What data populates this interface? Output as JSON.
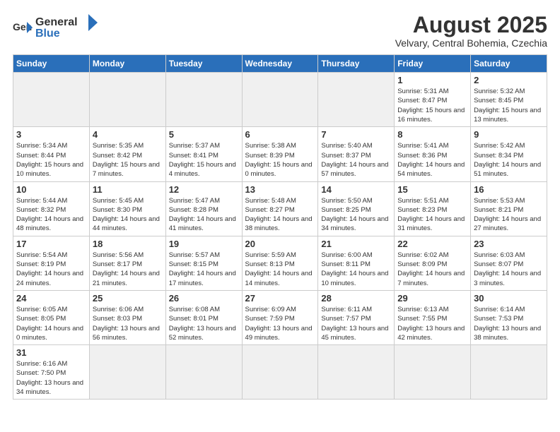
{
  "header": {
    "logo_general": "General",
    "logo_blue": "Blue",
    "month_title": "August 2025",
    "subtitle": "Velvary, Central Bohemia, Czechia"
  },
  "weekdays": [
    "Sunday",
    "Monday",
    "Tuesday",
    "Wednesday",
    "Thursday",
    "Friday",
    "Saturday"
  ],
  "weeks": [
    [
      {
        "day": "",
        "info": ""
      },
      {
        "day": "",
        "info": ""
      },
      {
        "day": "",
        "info": ""
      },
      {
        "day": "",
        "info": ""
      },
      {
        "day": "",
        "info": ""
      },
      {
        "day": "1",
        "info": "Sunrise: 5:31 AM\nSunset: 8:47 PM\nDaylight: 15 hours and 16 minutes."
      },
      {
        "day": "2",
        "info": "Sunrise: 5:32 AM\nSunset: 8:45 PM\nDaylight: 15 hours and 13 minutes."
      }
    ],
    [
      {
        "day": "3",
        "info": "Sunrise: 5:34 AM\nSunset: 8:44 PM\nDaylight: 15 hours and 10 minutes."
      },
      {
        "day": "4",
        "info": "Sunrise: 5:35 AM\nSunset: 8:42 PM\nDaylight: 15 hours and 7 minutes."
      },
      {
        "day": "5",
        "info": "Sunrise: 5:37 AM\nSunset: 8:41 PM\nDaylight: 15 hours and 4 minutes."
      },
      {
        "day": "6",
        "info": "Sunrise: 5:38 AM\nSunset: 8:39 PM\nDaylight: 15 hours and 0 minutes."
      },
      {
        "day": "7",
        "info": "Sunrise: 5:40 AM\nSunset: 8:37 PM\nDaylight: 14 hours and 57 minutes."
      },
      {
        "day": "8",
        "info": "Sunrise: 5:41 AM\nSunset: 8:36 PM\nDaylight: 14 hours and 54 minutes."
      },
      {
        "day": "9",
        "info": "Sunrise: 5:42 AM\nSunset: 8:34 PM\nDaylight: 14 hours and 51 minutes."
      }
    ],
    [
      {
        "day": "10",
        "info": "Sunrise: 5:44 AM\nSunset: 8:32 PM\nDaylight: 14 hours and 48 minutes."
      },
      {
        "day": "11",
        "info": "Sunrise: 5:45 AM\nSunset: 8:30 PM\nDaylight: 14 hours and 44 minutes."
      },
      {
        "day": "12",
        "info": "Sunrise: 5:47 AM\nSunset: 8:28 PM\nDaylight: 14 hours and 41 minutes."
      },
      {
        "day": "13",
        "info": "Sunrise: 5:48 AM\nSunset: 8:27 PM\nDaylight: 14 hours and 38 minutes."
      },
      {
        "day": "14",
        "info": "Sunrise: 5:50 AM\nSunset: 8:25 PM\nDaylight: 14 hours and 34 minutes."
      },
      {
        "day": "15",
        "info": "Sunrise: 5:51 AM\nSunset: 8:23 PM\nDaylight: 14 hours and 31 minutes."
      },
      {
        "day": "16",
        "info": "Sunrise: 5:53 AM\nSunset: 8:21 PM\nDaylight: 14 hours and 27 minutes."
      }
    ],
    [
      {
        "day": "17",
        "info": "Sunrise: 5:54 AM\nSunset: 8:19 PM\nDaylight: 14 hours and 24 minutes."
      },
      {
        "day": "18",
        "info": "Sunrise: 5:56 AM\nSunset: 8:17 PM\nDaylight: 14 hours and 21 minutes."
      },
      {
        "day": "19",
        "info": "Sunrise: 5:57 AM\nSunset: 8:15 PM\nDaylight: 14 hours and 17 minutes."
      },
      {
        "day": "20",
        "info": "Sunrise: 5:59 AM\nSunset: 8:13 PM\nDaylight: 14 hours and 14 minutes."
      },
      {
        "day": "21",
        "info": "Sunrise: 6:00 AM\nSunset: 8:11 PM\nDaylight: 14 hours and 10 minutes."
      },
      {
        "day": "22",
        "info": "Sunrise: 6:02 AM\nSunset: 8:09 PM\nDaylight: 14 hours and 7 minutes."
      },
      {
        "day": "23",
        "info": "Sunrise: 6:03 AM\nSunset: 8:07 PM\nDaylight: 14 hours and 3 minutes."
      }
    ],
    [
      {
        "day": "24",
        "info": "Sunrise: 6:05 AM\nSunset: 8:05 PM\nDaylight: 14 hours and 0 minutes."
      },
      {
        "day": "25",
        "info": "Sunrise: 6:06 AM\nSunset: 8:03 PM\nDaylight: 13 hours and 56 minutes."
      },
      {
        "day": "26",
        "info": "Sunrise: 6:08 AM\nSunset: 8:01 PM\nDaylight: 13 hours and 52 minutes."
      },
      {
        "day": "27",
        "info": "Sunrise: 6:09 AM\nSunset: 7:59 PM\nDaylight: 13 hours and 49 minutes."
      },
      {
        "day": "28",
        "info": "Sunrise: 6:11 AM\nSunset: 7:57 PM\nDaylight: 13 hours and 45 minutes."
      },
      {
        "day": "29",
        "info": "Sunrise: 6:13 AM\nSunset: 7:55 PM\nDaylight: 13 hours and 42 minutes."
      },
      {
        "day": "30",
        "info": "Sunrise: 6:14 AM\nSunset: 7:53 PM\nDaylight: 13 hours and 38 minutes."
      }
    ],
    [
      {
        "day": "31",
        "info": "Sunrise: 6:16 AM\nSunset: 7:50 PM\nDaylight: 13 hours and 34 minutes."
      },
      {
        "day": "",
        "info": ""
      },
      {
        "day": "",
        "info": ""
      },
      {
        "day": "",
        "info": ""
      },
      {
        "day": "",
        "info": ""
      },
      {
        "day": "",
        "info": ""
      },
      {
        "day": "",
        "info": ""
      }
    ]
  ]
}
